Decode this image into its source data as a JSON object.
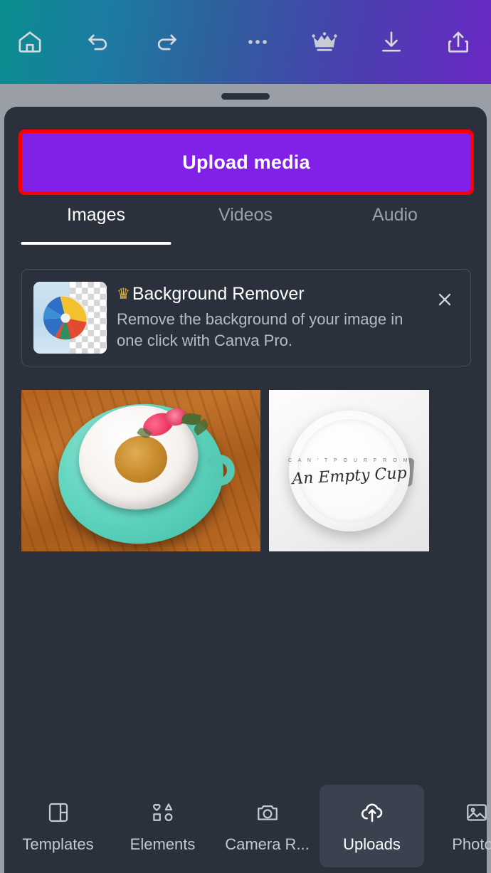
{
  "topbar": {
    "icons": [
      {
        "name": "home-icon",
        "label": "Home"
      },
      {
        "name": "undo-icon",
        "label": "Undo"
      },
      {
        "name": "redo-icon",
        "label": "Redo"
      },
      {
        "name": "more-options-icon",
        "label": "More options"
      },
      {
        "name": "crown-icon",
        "label": "Canva Pro"
      },
      {
        "name": "download-icon",
        "label": "Download"
      },
      {
        "name": "share-icon",
        "label": "Share"
      }
    ]
  },
  "panel": {
    "upload_button_label": "Upload media",
    "annotation_color": "#fe0000",
    "button_color": "#8121e8",
    "tabs": [
      {
        "label": "Images",
        "active": true
      },
      {
        "label": "Videos",
        "active": false
      },
      {
        "label": "Audio",
        "active": false
      }
    ],
    "banner": {
      "title": "Background Remover",
      "description": "Remove the background of your image in one click with Canva Pro.",
      "crown": "♛",
      "close_label": "✕",
      "thumbnail_name": "beach-ball-transparency-thumbnail"
    },
    "media": [
      {
        "name": "teacup-floral-upload",
        "alt": "Teal teacup with floral pattern on wooden table"
      },
      {
        "name": "empty-cup-upload",
        "alt": "White mug with An Empty Cup lettering",
        "arc_text": "C A N ' T   P O U R   F R O M",
        "script_text": "An Empty Cup"
      }
    ]
  },
  "bottom_nav": [
    {
      "label": "Templates",
      "icon": "templates-icon",
      "active": false
    },
    {
      "label": "Elements",
      "icon": "elements-icon",
      "active": false
    },
    {
      "label": "Camera R...",
      "icon": "camera-roll-icon",
      "active": false
    },
    {
      "label": "Uploads",
      "icon": "cloud-upload-icon",
      "active": true
    },
    {
      "label": "Photos",
      "icon": "photos-icon",
      "active": false
    }
  ]
}
